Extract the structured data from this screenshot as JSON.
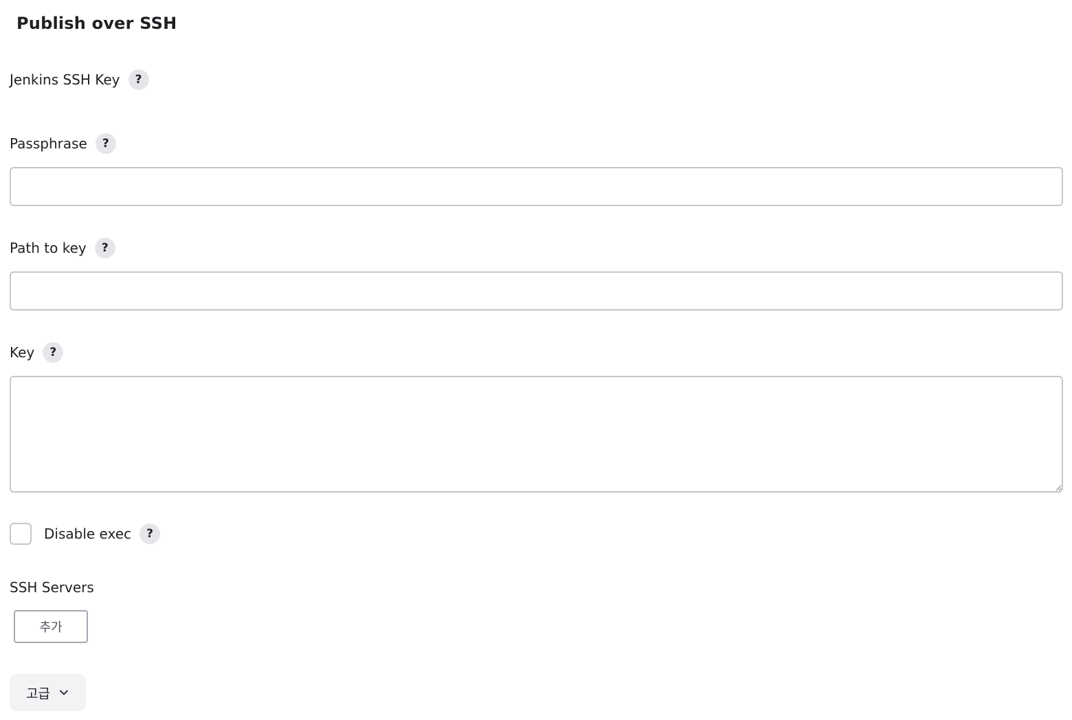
{
  "section": {
    "title": "Publish over SSH"
  },
  "fields": {
    "jenkins_ssh_key": {
      "label": "Jenkins SSH Key",
      "help": "?"
    },
    "passphrase": {
      "label": "Passphrase",
      "help": "?",
      "value": ""
    },
    "path_to_key": {
      "label": "Path to key",
      "help": "?",
      "value": ""
    },
    "key": {
      "label": "Key",
      "help": "?",
      "value": ""
    },
    "disable_exec": {
      "label": "Disable exec",
      "help": "?",
      "checked": false
    }
  },
  "ssh_servers": {
    "label": "SSH Servers",
    "add_button": "추가"
  },
  "advanced": {
    "label": "고급",
    "icon": "chevron-down-icon"
  },
  "colors": {
    "input_border": "#c3c8cc",
    "help_bg": "#e6e6ea",
    "button_border": "#a3a9b0",
    "advanced_bg": "#f3f3f6"
  }
}
